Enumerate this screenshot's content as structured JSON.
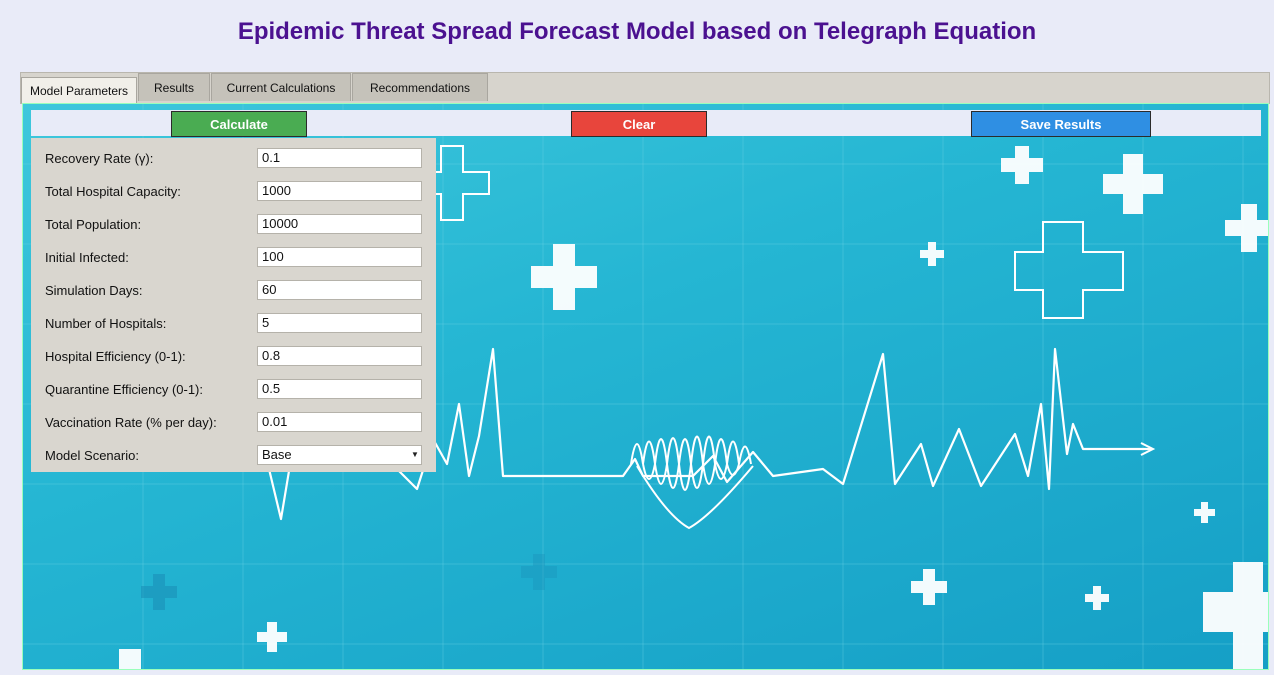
{
  "app": {
    "title": "Epidemic Threat Spread Forecast Model based on Telegraph Equation"
  },
  "tabs": [
    {
      "label": "Model Parameters",
      "active": true
    },
    {
      "label": "Results",
      "active": false
    },
    {
      "label": "Current Calculations",
      "active": false
    },
    {
      "label": "Recommendations",
      "active": false
    }
  ],
  "toolbar": {
    "calculate_label": "Calculate",
    "clear_label": "Clear",
    "save_label": "Save Results"
  },
  "params": [
    {
      "label": "Recovery Rate (γ):",
      "value": "0.1"
    },
    {
      "label": "Total Hospital Capacity:",
      "value": "1000"
    },
    {
      "label": "Total Population:",
      "value": "10000"
    },
    {
      "label": "Initial Infected:",
      "value": "100"
    },
    {
      "label": "Simulation Days:",
      "value": "60"
    },
    {
      "label": "Number of Hospitals:",
      "value": "5"
    },
    {
      "label": "Hospital Efficiency (0-1):",
      "value": "0.8"
    },
    {
      "label": "Quarantine Efficiency (0-1):",
      "value": "0.5"
    },
    {
      "label": "Vaccination Rate (% per day):",
      "value": "0.01"
    }
  ],
  "scenario": {
    "label": "Model Scenario:",
    "value": "Base"
  },
  "colors": {
    "title": "#4b1190",
    "calculate": "#4aac52",
    "clear": "#e8453c",
    "save": "#2f8fe3"
  },
  "icons": {
    "background": "medical-ecg-background",
    "dropdown": "chevron-down-icon"
  }
}
